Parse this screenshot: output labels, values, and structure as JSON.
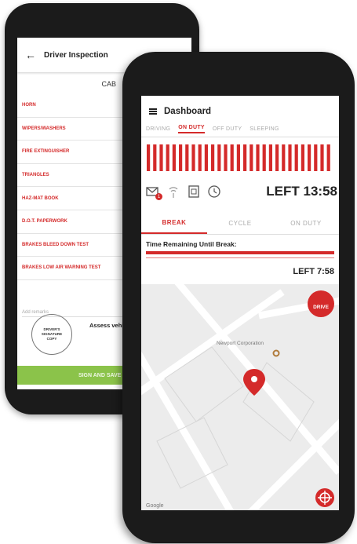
{
  "back_phone": {
    "header_title": "Driver Inspection",
    "section_label": "CAB",
    "items": [
      "HORN",
      "WIPERS/WASHERS",
      "FIRE EXTINGUISHER",
      "TRIANGLES",
      "HAZ-MAT BOOK",
      "D.O.T. PAPERWORK",
      "BRAKES BLEED DOWN TEST",
      "BRAKES LOW AIR WARNING TEST"
    ],
    "remarks_placeholder": "Add remarks",
    "assess_label": "Assess vehicle condi",
    "stamp_text_1": "DRIVER'S",
    "stamp_text_2": "SIGNATURE",
    "stamp_text_3": "COPY",
    "sign_button": "SIGN AND SAVE RE"
  },
  "front_phone": {
    "title": "Dashboard",
    "status_tabs": [
      "DRIVING",
      "ON DUTY",
      "OFF DUTY",
      "SLEEPING"
    ],
    "active_status_tab": "ON DUTY",
    "left_main": "LEFT 13:58",
    "message_badge": "1",
    "sub_tabs": [
      "BREAK",
      "CYCLE",
      "ON DUTY"
    ],
    "active_sub_tab": "BREAK",
    "break_label": "Time Remaining Until Break:",
    "left_break": "LEFT 7:58",
    "map_label": "Newport Corporation",
    "drive_button": "DRIVE",
    "google_logo": "Google"
  },
  "colors": {
    "accent": "#d42a2a",
    "sign_button": "#8bc34a"
  }
}
